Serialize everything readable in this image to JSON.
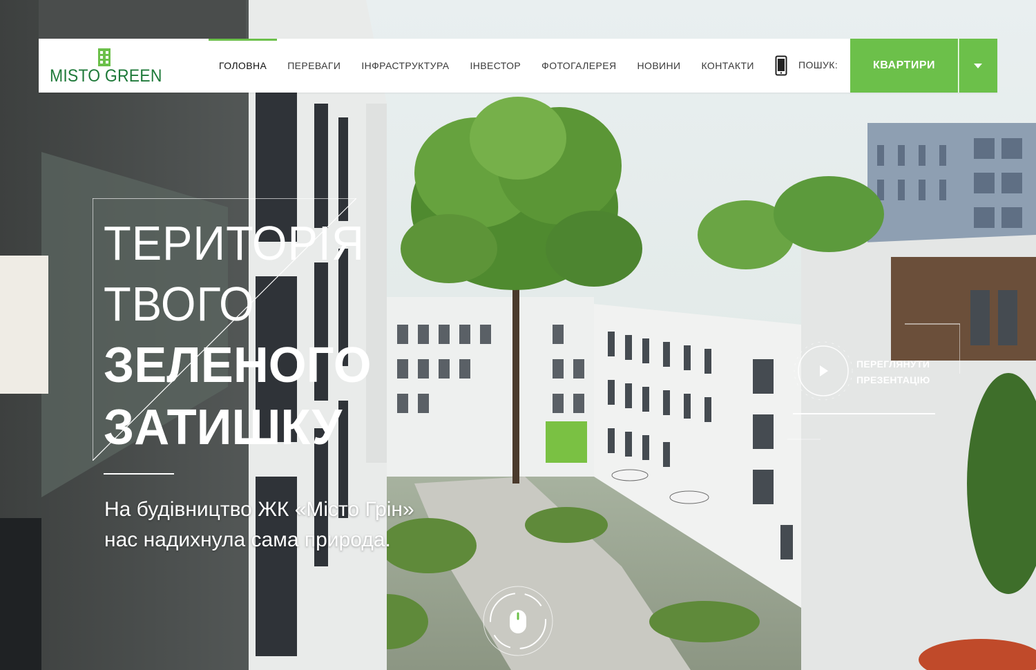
{
  "logo": {
    "text": "MISTO GREEN"
  },
  "nav": {
    "items": [
      {
        "label": "ГОЛОВНА",
        "active": true
      },
      {
        "label": "ПЕРЕВАГИ"
      },
      {
        "label": "ІНФРАСТРУКТУРА"
      },
      {
        "label": "ІНВЕСТОР"
      },
      {
        "label": "ФОТОГАЛЕРЕЯ"
      },
      {
        "label": "НОВИНИ"
      },
      {
        "label": "КОНТАКТИ"
      }
    ]
  },
  "header": {
    "phone_icon": "phone-icon",
    "search_label": "ПОШУК:",
    "apartments_label": "КВАРТИРИ",
    "dropdown_icon": "chevron-down-icon"
  },
  "hero": {
    "line1": "ТЕРИТОРІЯ",
    "line2": "ТВОГО",
    "line3": "ЗЕЛЕНОГО",
    "line4": "ЗАТИШКУ",
    "subtitle_line1": "На будівництво ЖК «Місто Грін»",
    "subtitle_line2": "нас надихнула сама природа."
  },
  "presentation": {
    "line1": "ПЕРЕГЛЯНУТИ",
    "line2": "ПРЕЗЕНТАЦІЮ",
    "icon": "play-icon"
  },
  "scroll": {
    "icon": "mouse-scroll-icon"
  },
  "colors": {
    "accent": "#6cc04a",
    "logo": "#1f7a3a"
  }
}
